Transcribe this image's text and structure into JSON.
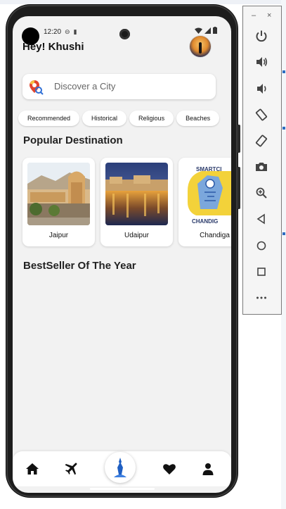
{
  "status_bar": {
    "time": "12:20"
  },
  "header": {
    "greeting": "Hey! Khushi"
  },
  "search": {
    "placeholder": "Discover a City"
  },
  "chips": [
    "Recommended",
    "Historical",
    "Religious",
    "Beaches"
  ],
  "sections": {
    "popular": "Popular Destination",
    "bestseller": "BestSeller Of The Year"
  },
  "destinations": [
    {
      "name": "Jaipur"
    },
    {
      "name": "Udaipur"
    },
    {
      "name": "Chandiga"
    }
  ],
  "chandigarh_logo_text": "SMARTCI",
  "chandigarh_logo_bottom": "CHANDIG",
  "emulator": {
    "minimize": "–",
    "close": "×"
  },
  "colors": {
    "screen_bg": "#f2f2f2",
    "accent_blue": "#1f5fc2",
    "phone_body": "#1d1d1d"
  },
  "nav_icons": [
    "home-icon",
    "flight-icon",
    "explore-icon",
    "heart-icon",
    "person-icon"
  ]
}
